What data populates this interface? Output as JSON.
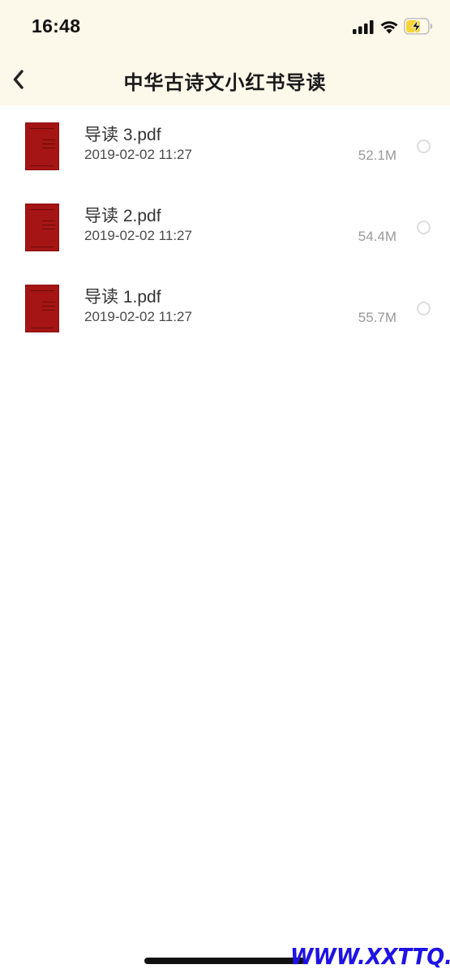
{
  "status_bar": {
    "time": "16:48",
    "icons": [
      "signal-icon",
      "wifi-icon",
      "battery-charging-icon"
    ],
    "battery_color": "#f5d43b"
  },
  "nav": {
    "back_icon": "chevron-left-icon",
    "title": "中华古诗文小红书导读"
  },
  "files": [
    {
      "name": "导读 3.pdf",
      "date": "2019-02-02 11:27",
      "size": "52.1M",
      "selected": false
    },
    {
      "name": "导读 2.pdf",
      "date": "2019-02-02 11:27",
      "size": "54.4M",
      "selected": false
    },
    {
      "name": "导读 1.pdf",
      "date": "2019-02-02 11:27",
      "size": "55.7M",
      "selected": false
    }
  ],
  "watermark": "WWW.XXTTQ.COM",
  "colors": {
    "header_bg": "#fcf8ea",
    "thumbnail": "#a51515",
    "watermark": "#1e12e6"
  }
}
